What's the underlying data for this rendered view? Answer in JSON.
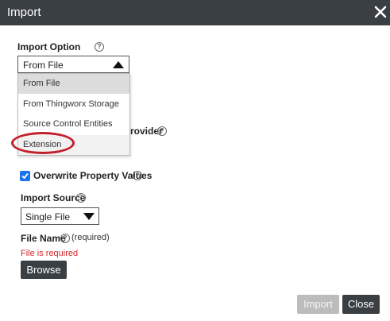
{
  "dialog": {
    "title": "Import"
  },
  "import_option": {
    "label": "Import Option",
    "selected": "From File",
    "options": [
      "From File",
      "From Thingworx Storage",
      "Source Control Entities",
      "Extension"
    ]
  },
  "obscured": {
    "partial_label_1": "rovider"
  },
  "overwrite": {
    "label": "Overwrite Property Values",
    "checked": true
  },
  "import_source": {
    "label": "Import Source",
    "selected": "Single File"
  },
  "file_name": {
    "label": "File Name",
    "required": "(required)",
    "error": "File is required",
    "browse_label": "Browse"
  },
  "footer": {
    "import_label": "Import",
    "close_label": "Close"
  },
  "colors": {
    "header": "#3a3f44",
    "accent": "#1a73e8",
    "error": "#d9262b",
    "highlight": "#c21f2b"
  }
}
